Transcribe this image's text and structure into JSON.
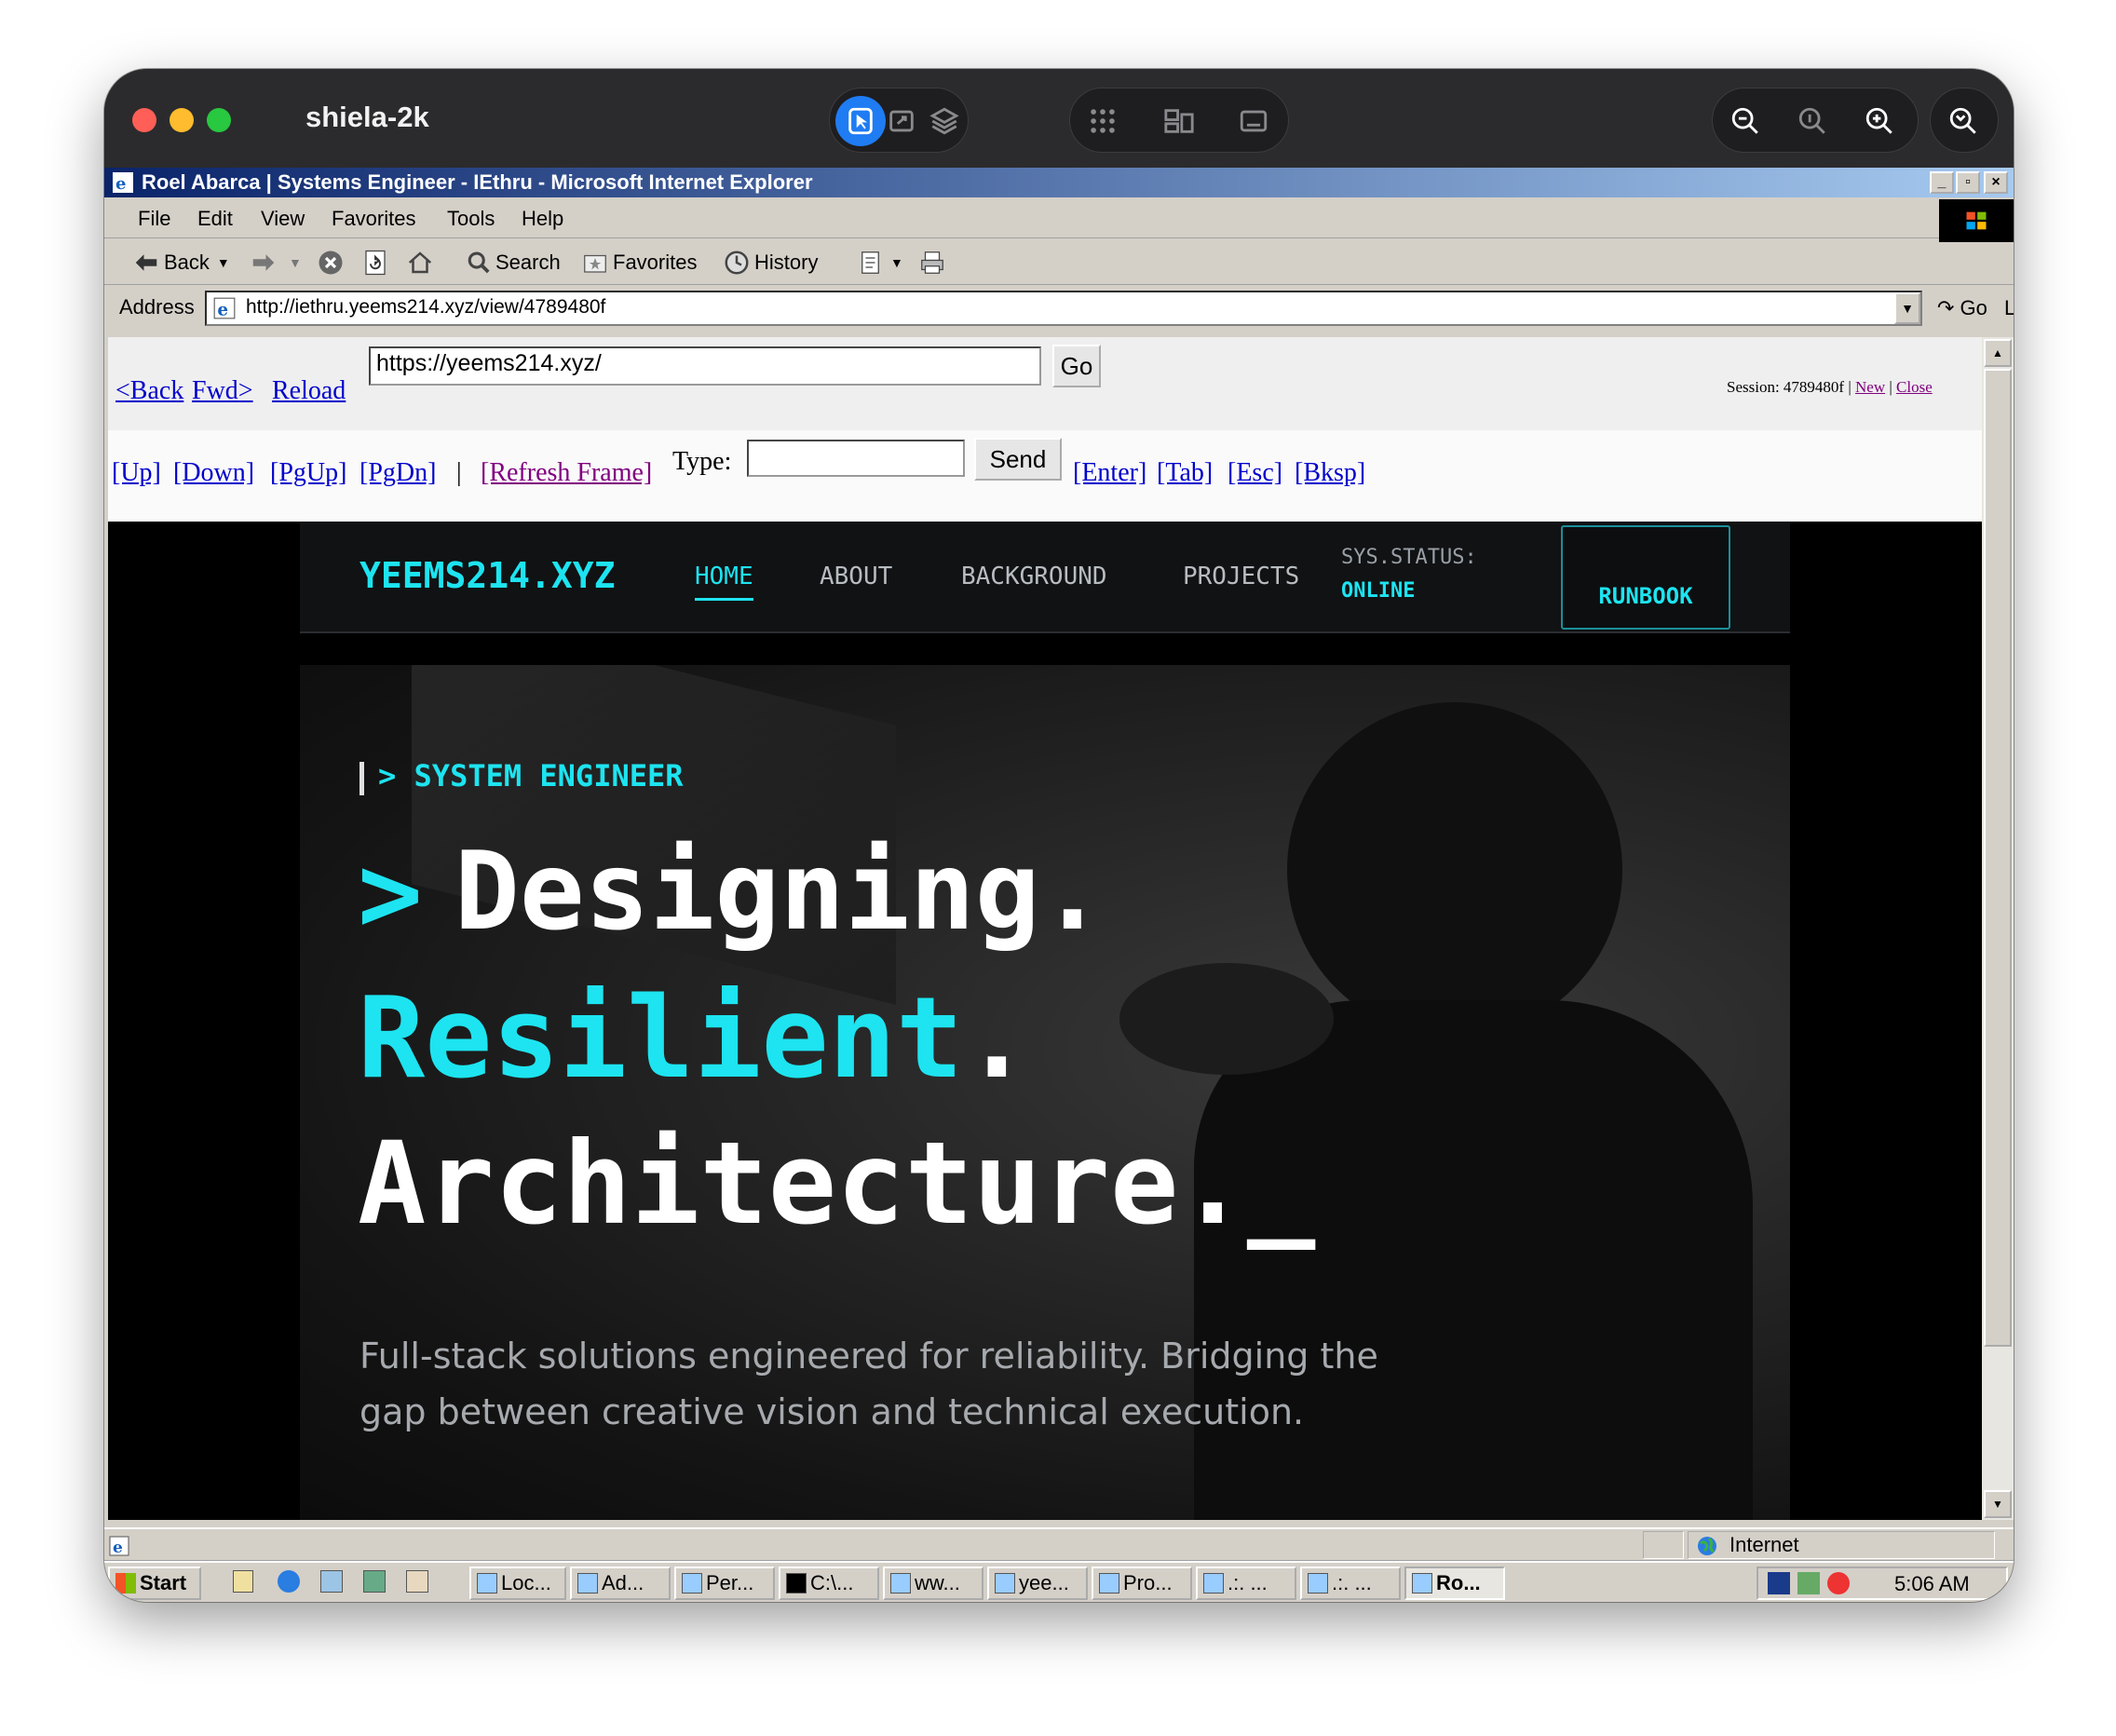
{
  "host": {
    "title": "shiela-2k",
    "traffic_colors": {
      "close": "#ff5f57",
      "minimize": "#febc2e",
      "zoom": "#28c840"
    }
  },
  "ie": {
    "window_title": "Roel Abarca | Systems Engineer - IEthru - Microsoft Internet Explorer",
    "menu": [
      "File",
      "Edit",
      "View",
      "Favorites",
      "Tools",
      "Help"
    ],
    "toolbar": {
      "back": "Back",
      "search": "Search",
      "favorites": "Favorites",
      "history": "History"
    },
    "address_label": "Address",
    "address_url": "http://iethru.yeems214.xyz/view/4789480f",
    "go_label": "Go",
    "links_label": "Links"
  },
  "proxy": {
    "back": "<Back",
    "fwd": "Fwd>",
    "reload": "Reload",
    "url_value": "https://yeems214.xyz/",
    "go": "Go",
    "session_label": "Session: 4789480f |",
    "new": "New",
    "sep": "|",
    "close": "Close",
    "up": "[Up]",
    "down": "[Down]",
    "pgup": "[PgUp]",
    "pgdn": "[PgDn]",
    "bar": "|",
    "refresh": "[Refresh Frame]",
    "type_label": "Type:",
    "send": "Send",
    "enter": "[Enter]",
    "tab": "[Tab]",
    "esc": "[Esc]",
    "bksp": "[Bksp]"
  },
  "site": {
    "brand": "YEEMS214.XYZ",
    "nav": [
      "HOME",
      "ABOUT",
      "BACKGROUND",
      "PROJECTS"
    ],
    "status_label": "SYS.STATUS:",
    "status_value": "ONLINE",
    "runbook": "RUNBOOK",
    "tagline": "> SYSTEM ENGINEER",
    "prompt": ">",
    "line1": "Designing.",
    "line2_word": "Resilient",
    "line2_dot": ".",
    "line3": "Architecture.",
    "cursor": "_",
    "desc_1": "Full-stack solutions engineered for reliability. Bridging the",
    "desc_2": "gap between creative vision and technical execution.",
    "accent": "#1de4f0"
  },
  "statusbar": {
    "zone": "Internet"
  },
  "taskbar": {
    "start": "Start",
    "tasks": [
      "Loc...",
      "Ad...",
      "Per...",
      "C:\\...",
      "ww...",
      "yee...",
      "Pro...",
      ".:. ...",
      ".:. ...",
      "Ro..."
    ],
    "clock": "5:06 AM"
  }
}
